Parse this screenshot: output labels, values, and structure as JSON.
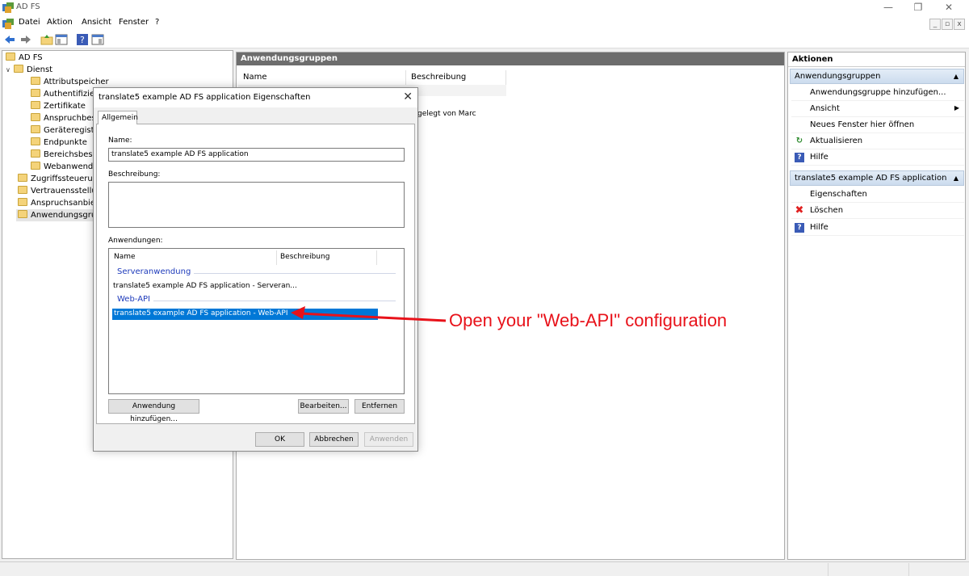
{
  "window": {
    "title": "AD FS",
    "controls": [
      "—",
      "❐",
      "✕"
    ],
    "mdi_controls": [
      "_",
      "▫",
      "x"
    ]
  },
  "menu": [
    "Datei",
    "Aktion",
    "Ansicht",
    "Fenster",
    "?"
  ],
  "toolbar": {
    "icons": [
      "back-arrow-icon",
      "forward-arrow-icon",
      "folder-up-icon",
      "console-tree-icon",
      "help-icon",
      "show-hide-pane-icon"
    ]
  },
  "tree": {
    "root": "AD FS",
    "dienst": "Dienst",
    "dienst_children": [
      "Attributspeicher",
      "Authentifizier",
      "Zertifikate",
      "Anspruchbesc",
      "Geräteregistrie",
      "Endpunkte",
      "Bereichsbesch",
      "Webanwendu"
    ],
    "top_items": [
      "Zugriffssteuerung",
      "Vertrauensstellung",
      "Anspruchsanbiete",
      "Anwendungsgrup"
    ]
  },
  "center": {
    "header": "Anwendungsgruppen",
    "columns": [
      "Name",
      "Beschreibung"
    ],
    "partial_desc": "gelegt von Marc"
  },
  "actions": {
    "header": "Aktionen",
    "section1": "Anwendungsgruppen",
    "section1_items": [
      "Anwendungsgruppe hinzufügen...",
      "Ansicht",
      "Neues Fenster hier öffnen",
      "Aktualisieren",
      "Hilfe"
    ],
    "section2": "translate5 example AD FS application",
    "section2_items": [
      "Eigenschaften",
      "Löschen",
      "Hilfe"
    ]
  },
  "dialog": {
    "title": "translate5 example AD FS application Eigenschaften",
    "tab": "Allgemein",
    "name_label": "Name:",
    "name_value": "translate5 example AD FS application",
    "desc_label": "Beschreibung:",
    "desc_value": "",
    "apps_label": "Anwendungen:",
    "apps_columns": [
      "Name",
      "Beschreibung"
    ],
    "group_server": "Serveranwendung",
    "server_app": "translate5 example AD FS application - Serveran...",
    "group_webapi": "Web-API",
    "webapi_app": "translate5 example AD FS application - Web-API",
    "btn_add": "Anwendung hinzufügen...",
    "btn_edit": "Bearbeiten...",
    "btn_remove": "Entfernen",
    "btn_ok": "OK",
    "btn_cancel": "Abbrechen",
    "btn_apply": "Anwenden"
  },
  "annotation": {
    "text": "Open your \"Web-API\" configuration",
    "color": "#e8121a"
  },
  "colors": {
    "selection": "#0078d7",
    "header_gray": "#6d6d6d",
    "action_section": "#d6e3f2"
  }
}
